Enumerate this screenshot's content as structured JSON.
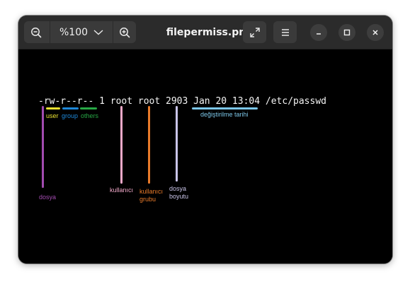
{
  "toolbar": {
    "zoom_out_icon": "zoom-out-icon",
    "zoom_level": "%100",
    "zoom_dropdown_icon": "chevron-down-icon",
    "zoom_in_icon": "zoom-in-icon",
    "fullscreen_icon": "fullscreen-icon",
    "menu_icon": "hamburger-menu-icon"
  },
  "window": {
    "title": "filepermiss.png",
    "minimize_icon": "minimize-icon",
    "maximize_icon": "maximize-icon",
    "close_icon": "close-icon"
  },
  "image": {
    "command_line": "-rw-r--r-- 1 root root 2903 Jan 20 13:04 /etc/passwd",
    "annotations": {
      "user": "user",
      "group": "group",
      "others": "others",
      "date": "değiştirilme tarihi",
      "type": "dosya",
      "owner": "kullanıcı",
      "owner_group": "kullanıcı\ngrubu",
      "size": "dosya\nboyutu"
    },
    "colors": {
      "user": "#e8e030",
      "group": "#1e88d8",
      "others": "#27a845",
      "date": "#7cc6e8",
      "type": "#a24bb0",
      "owner": "#f0a8c8",
      "owner_group": "#e87a2a",
      "size": "#c9c4e8"
    }
  }
}
